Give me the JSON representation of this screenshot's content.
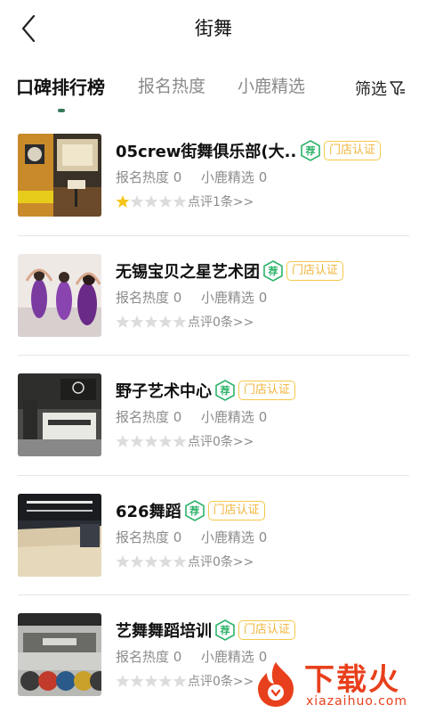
{
  "header": {
    "title": "街舞"
  },
  "tabs": [
    {
      "label": "口碑排行榜",
      "active": true
    },
    {
      "label": "报名热度",
      "active": false
    },
    {
      "label": "小鹿精选",
      "active": false
    }
  ],
  "filter": {
    "label": "筛选"
  },
  "items": [
    {
      "name": "05crew街舞俱乐部(大...",
      "badge_rec": "荐",
      "badge_cert": "门店认证",
      "heat_label": "报名热度",
      "heat_value": "0",
      "pick_label": "小鹿精选",
      "pick_value": "0",
      "rating": 1,
      "max_rating": 5,
      "review_text": "点评1条>>"
    },
    {
      "name": "无锡宝贝之星艺术团",
      "badge_rec": "荐",
      "badge_cert": "门店认证",
      "heat_label": "报名热度",
      "heat_value": "0",
      "pick_label": "小鹿精选",
      "pick_value": "0",
      "rating": 0,
      "max_rating": 5,
      "review_text": "点评0条>>"
    },
    {
      "name": "野子艺术中心",
      "badge_rec": "荐",
      "badge_cert": "门店认证",
      "heat_label": "报名热度",
      "heat_value": "0",
      "pick_label": "小鹿精选",
      "pick_value": "0",
      "rating": 0,
      "max_rating": 5,
      "review_text": "点评0条>>"
    },
    {
      "name": "626舞蹈",
      "badge_rec": "荐",
      "badge_cert": "门店认证",
      "heat_label": "报名热度",
      "heat_value": "0",
      "pick_label": "小鹿精选",
      "pick_value": "0",
      "rating": 0,
      "max_rating": 5,
      "review_text": "点评0条>>"
    },
    {
      "name": "艺舞舞蹈培训",
      "badge_rec": "荐",
      "badge_cert": "门店认证",
      "heat_label": "报名热度",
      "heat_value": "0",
      "pick_label": "小鹿精选",
      "pick_value": "0",
      "rating": 0,
      "max_rating": 5,
      "review_text": "点评0条>>"
    }
  ],
  "colors": {
    "star_filled": "#f5c518",
    "star_empty": "#dcdcdc",
    "accent_green": "#2db36a",
    "cert_yellow": "#f5c84a",
    "watermark_red": "#e8401c"
  },
  "watermark": {
    "text": "下载火",
    "sub": "xiazaihuo.com"
  }
}
